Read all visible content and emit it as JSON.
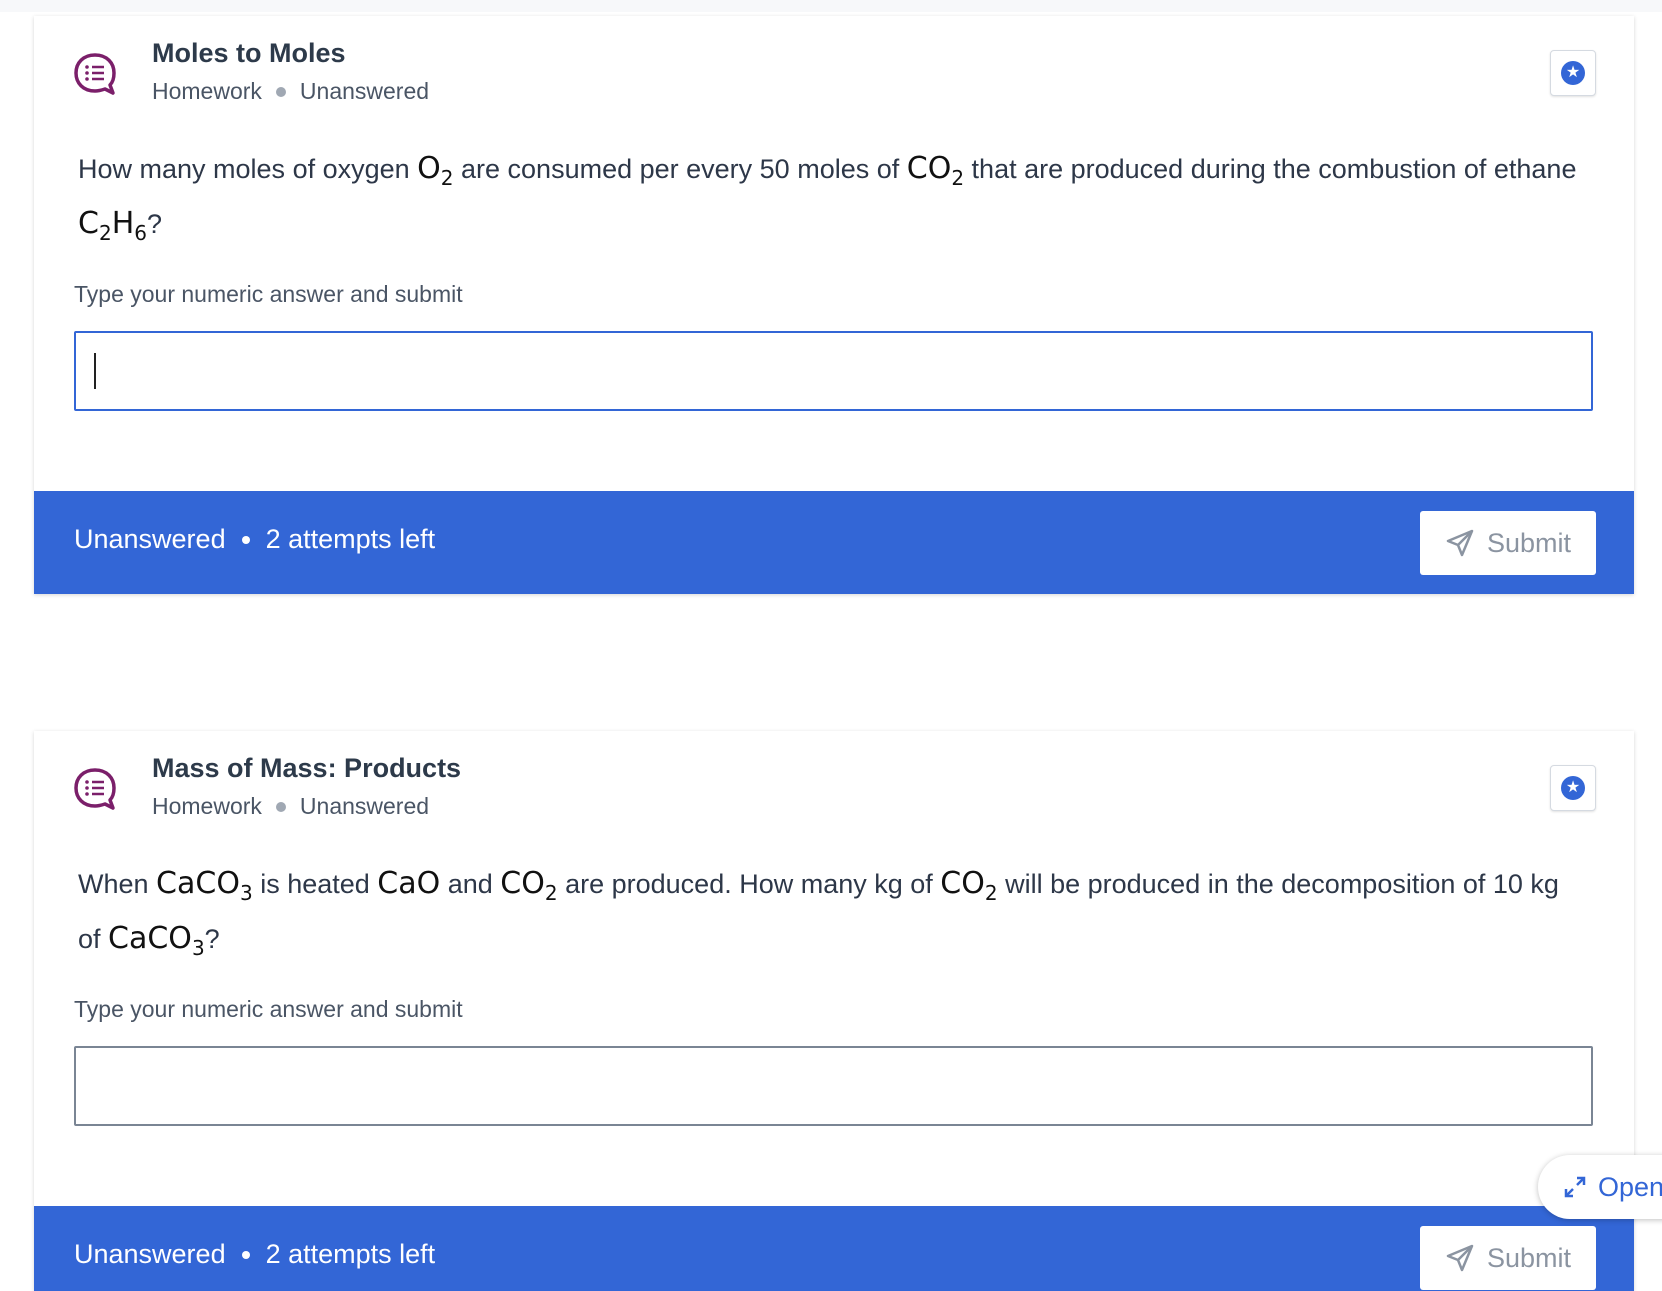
{
  "questions": [
    {
      "title": "Moles to Moles",
      "type": "Homework",
      "state": "Unanswered",
      "text": {
        "p1": "How many moles of oxygen ",
        "c1": "O",
        "c1_sub": "2",
        "p2": " are consumed per every 50 moles of ",
        "c2": "CO",
        "c2_sub": "2",
        "p3": " that are produced during the combustion of ethane ",
        "c3a": "C",
        "c3a_sub": "2",
        "c3b": "H",
        "c3b_sub": "6",
        "p4": "?"
      },
      "prompt": "Type your numeric answer and submit",
      "answer_value": "",
      "status": "Unanswered",
      "attempts": "2 attempts left",
      "submit_label": "Submit"
    },
    {
      "title": "Mass of Mass: Products",
      "type": "Homework",
      "state": "Unanswered",
      "text": {
        "p1": "When ",
        "c1": "CaCO",
        "c1_sub": "3",
        "p2": " is heated ",
        "c2": "CaO",
        "p3": " and ",
        "c3": "CO",
        "c3_sub": "2",
        "p4": " are produced. How many kg of ",
        "c4": "CO",
        "c4_sub": "2",
        "p5": " will be produced in the decomposition of 10 kg of ",
        "c5": "CaCO",
        "c5_sub": "3",
        "p6": "?"
      },
      "prompt": "Type your numeric answer and submit",
      "answer_value": "",
      "status": "Unanswered",
      "attempts": "2 attempts left",
      "submit_label": "Submit"
    }
  ],
  "open_button": {
    "label": "Open",
    "icon": "expand-icon"
  },
  "colors": {
    "accent": "#3366d6",
    "icon_purple": "#7b1f6a",
    "muted": "#8b94a1"
  },
  "icons": {
    "question_type": "chat-list-icon",
    "bookmark": "star-icon",
    "submit": "paper-plane-icon"
  }
}
